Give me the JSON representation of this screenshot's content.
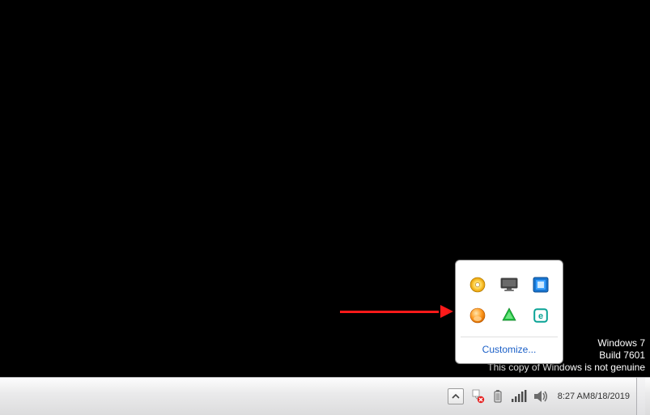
{
  "watermark": {
    "line1": "Windows 7",
    "line2": "Build 7601",
    "line3": "This copy of Windows is not genuine"
  },
  "tray_flyout": {
    "customize_label": "Customize...",
    "icons": {
      "disc": "optical-disc-icon",
      "monitor": "monitor-icon",
      "intel_graphics": "intel-graphics-icon",
      "orange_app": "media-app-icon",
      "green_app": "glasswire-icon",
      "eset": "eset-icon"
    }
  },
  "annotation": {
    "arrow": "red-arrow"
  },
  "systray": {
    "overflow_tooltip": "Show hidden icons",
    "action_center": "action-center-icon",
    "battery": "battery-icon",
    "network": "network-signal-icon",
    "volume": "volume-icon"
  },
  "clock": {
    "time": "8:27 AM",
    "date": "8/18/2019"
  }
}
